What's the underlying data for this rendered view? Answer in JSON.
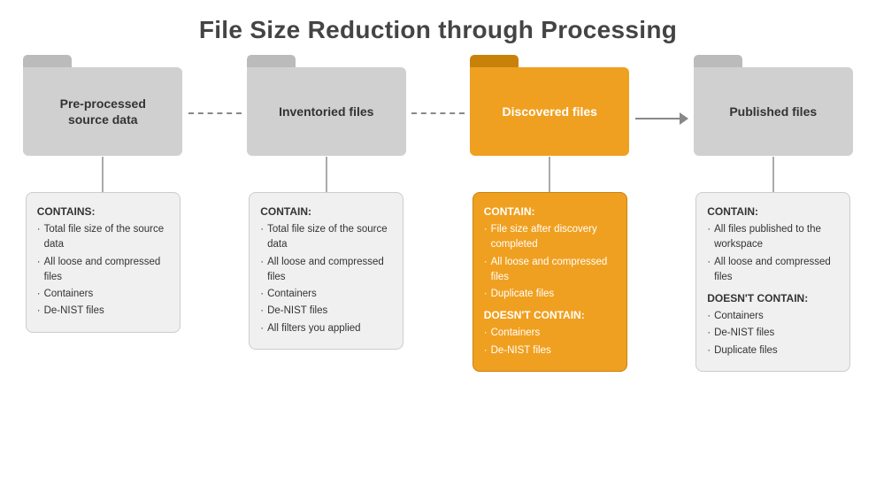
{
  "title": "File Size Reduction through Processing",
  "folders": [
    {
      "id": "pre-processed",
      "label": "Pre-processed\nsource data",
      "type": "gray",
      "connector": "dashed"
    },
    {
      "id": "inventoried",
      "label": "Inventoried files",
      "type": "gray",
      "connector": "dashed"
    },
    {
      "id": "discovered",
      "label": "Discovered files",
      "type": "orange",
      "connector": "solid-arrow"
    },
    {
      "id": "published",
      "label": "Published files",
      "type": "gray",
      "connector": null
    }
  ],
  "cards": [
    {
      "id": "pre-processed-card",
      "type": "gray",
      "contains_title": "CONTAINS:",
      "contains_items": [
        "Total file size of the source data",
        "All loose and compressed files",
        "Containers",
        "De-NIST files"
      ],
      "doesnt_contain_title": null,
      "doesnt_contain_items": []
    },
    {
      "id": "inventoried-card",
      "type": "gray",
      "contains_title": "CONTAIN:",
      "contains_items": [
        "Total file size of the source data",
        "All loose and compressed files",
        "Containers",
        "De-NIST files",
        "All filters you applied"
      ],
      "doesnt_contain_title": null,
      "doesnt_contain_items": []
    },
    {
      "id": "discovered-card",
      "type": "orange",
      "contains_title": "CONTAIN:",
      "contains_items": [
        "File size after discovery completed",
        "All loose and compressed files",
        "Duplicate files"
      ],
      "doesnt_contain_title": "DOESN'T CONTAIN:",
      "doesnt_contain_items": [
        "Containers",
        "De-NIST files"
      ]
    },
    {
      "id": "published-card",
      "type": "gray",
      "contains_title": "CONTAIN:",
      "contains_items": [
        "All files published to the workspace",
        "All loose and compressed files"
      ],
      "doesnt_contain_title": "DOESN'T CONTAIN:",
      "doesnt_contain_items": [
        "Containers",
        "De-NIST files",
        "Duplicate files"
      ]
    }
  ]
}
